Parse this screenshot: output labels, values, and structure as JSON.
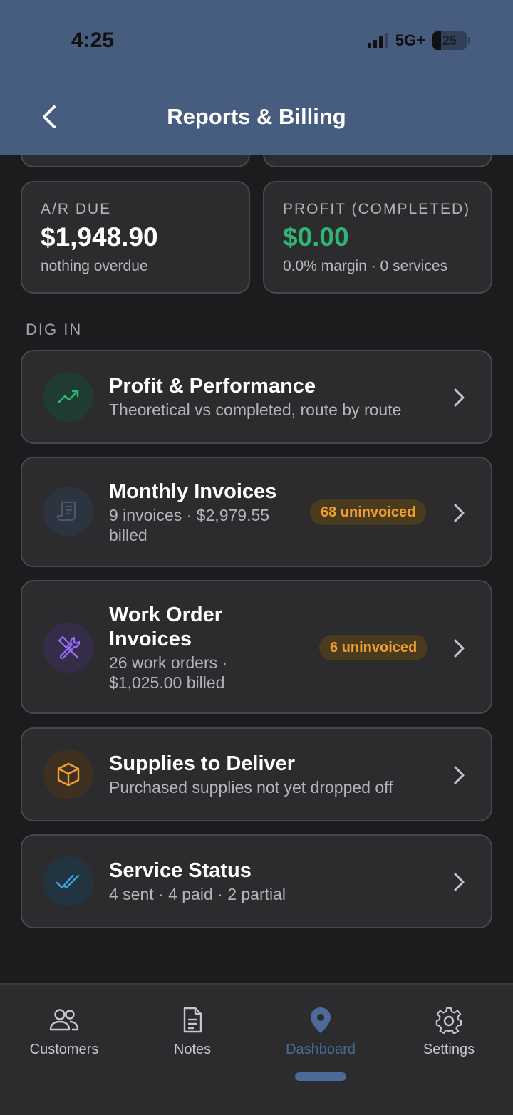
{
  "status_bar": {
    "time": "4:25",
    "network": "5G+",
    "battery": "25"
  },
  "header": {
    "title": "Reports & Billing"
  },
  "stats": [
    {
      "label": "A/R DUE",
      "value": "$1,948.90",
      "sub": "nothing overdue"
    },
    {
      "label": "PROFIT (COMPLETED)",
      "value": "$0.00",
      "sub": "0.0% margin · 0 services",
      "value_color": "#2fb574"
    }
  ],
  "section": {
    "label": "DIG IN"
  },
  "rows": [
    {
      "title": "Profit & Performance",
      "sub": "Theoretical vs completed, route by route",
      "icon": "trending-up-icon"
    },
    {
      "title": "Monthly Invoices",
      "sub_line1": "9 invoices · $2,979.55",
      "sub_line2": "billed",
      "badge": "68 uninvoiced",
      "icon": "receipt-icon"
    },
    {
      "title_line1": "Work Order",
      "title_line2": "Invoices",
      "sub_line1": "26 work orders ·",
      "sub_line2": "$1,025.00 billed",
      "badge": "6 uninvoiced",
      "icon": "tools-icon"
    },
    {
      "title": "Supplies to Deliver",
      "sub": "Purchased supplies not yet dropped off",
      "icon": "box-icon"
    },
    {
      "title": "Service Status",
      "sub": "4 sent · 4 paid · 2 partial",
      "icon": "double-check-icon"
    }
  ],
  "tabs": [
    {
      "label": "Customers",
      "icon": "people-icon"
    },
    {
      "label": "Notes",
      "icon": "document-icon"
    },
    {
      "label": "Dashboard",
      "icon": "map-pin-icon",
      "active": true
    },
    {
      "label": "Settings",
      "icon": "gear-icon"
    }
  ],
  "colors": {
    "header": "#465d80",
    "accent": "#4c6b98",
    "badge_text": "#f0a030",
    "profit_green": "#2fb574"
  }
}
